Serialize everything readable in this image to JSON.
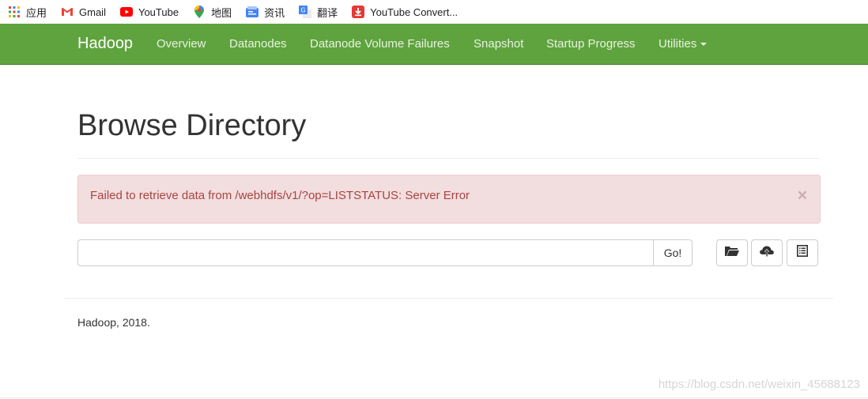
{
  "bookmarks": [
    {
      "label": "应用",
      "icon": "apps-grid-icon"
    },
    {
      "label": "Gmail",
      "icon": "gmail-icon"
    },
    {
      "label": "YouTube",
      "icon": "youtube-icon"
    },
    {
      "label": "地图",
      "icon": "maps-pin-icon"
    },
    {
      "label": "资讯",
      "icon": "news-icon"
    },
    {
      "label": "翻译",
      "icon": "translate-icon"
    },
    {
      "label": "YouTube Convert...",
      "icon": "download-icon"
    }
  ],
  "navbar": {
    "brand": "Hadoop",
    "items": [
      "Overview",
      "Datanodes",
      "Datanode Volume Failures",
      "Snapshot",
      "Startup Progress",
      "Utilities"
    ],
    "color": "#5fa33e"
  },
  "page": {
    "title": "Browse Directory"
  },
  "alert": {
    "message": "Failed to retrieve data from /webhdfs/v1/?op=LISTSTATUS: Server Error",
    "close": "×"
  },
  "path_search": {
    "value": "",
    "go_label": "Go!"
  },
  "actions": [
    "create-directory",
    "upload",
    "cut-paste-list"
  ],
  "footer": {
    "text": "Hadoop, 2018."
  },
  "watermark": "https://blog.csdn.net/weixin_45688123"
}
